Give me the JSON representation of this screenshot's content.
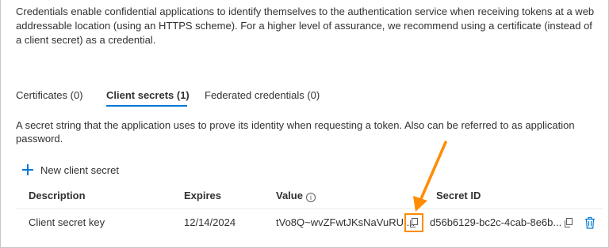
{
  "intro_text": "Credentials enable confidential applications to identify themselves to the authentication service when receiving tokens at a web addressable location (using an HTTPS scheme). For a higher level of assurance, we recommend using a certificate (instead of a client secret) as a credential.",
  "tabs": [
    {
      "label": "Certificates (0)",
      "active": false
    },
    {
      "label": "Client secrets (1)",
      "active": true
    },
    {
      "label": "Federated credentials (0)",
      "active": false
    }
  ],
  "description": "A secret string that the application uses to prove its identity when requesting a token. Also can be referred to as application password.",
  "new_secret_label": "New client secret",
  "table": {
    "headers": {
      "description": "Description",
      "expires": "Expires",
      "value": "Value",
      "secret_id": "Secret ID"
    },
    "rows": [
      {
        "description": "Client secret key",
        "expires": "12/14/2024",
        "value": "tVo8Q~wvZFwtJKsNaVuRU ...",
        "secret_id": "d56b6129-bc2c-4cab-8e6b..."
      }
    ]
  },
  "colors": {
    "accent": "#0078d4",
    "annotation": "#ff8c00",
    "text": "#323130"
  },
  "icons": {
    "add": "plus-icon",
    "info": "info-icon",
    "copy": "copy-icon",
    "delete": "trash-icon",
    "annotation_arrow": "arrow-icon"
  }
}
